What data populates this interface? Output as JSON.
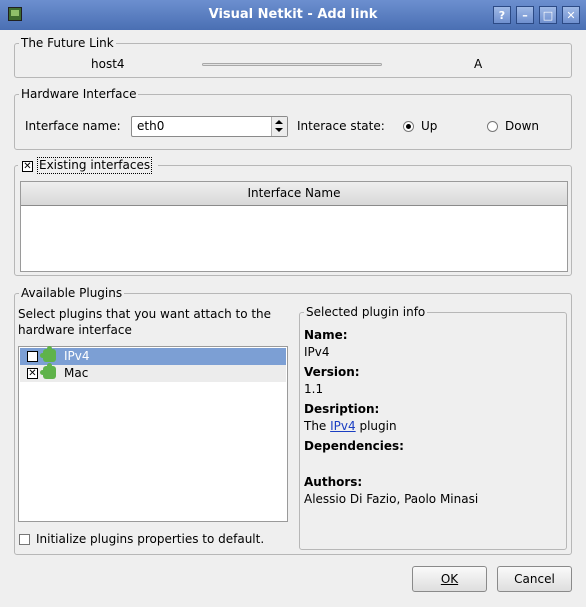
{
  "window": {
    "title": "Visual Netkit - Add link",
    "help_label": "?",
    "minimize_label": "–",
    "maximize_label": "□",
    "close_label": "✕"
  },
  "future_link": {
    "legend": "The Future Link",
    "host": "host4",
    "collision_domain": "A"
  },
  "hardware_interface": {
    "legend": "Hardware Interface",
    "name_label": "Interface name:",
    "name_value": "eth0",
    "state_label": "Interace state:",
    "state_options": [
      "Up",
      "Down"
    ],
    "state_selected": "Up"
  },
  "existing_interfaces": {
    "legend": "Existing interfaces",
    "checked": true,
    "column_header": "Interface Name"
  },
  "available_plugins": {
    "legend": "Available Plugins",
    "instructions": [
      "Select plugins that you want attach to the",
      "hardware interface"
    ],
    "plugins": [
      {
        "name": "IPv4",
        "checked": true,
        "selected": true
      },
      {
        "name": "Mac",
        "checked": true,
        "selected": false
      }
    ],
    "init_default_label": "Initialize plugins properties to default.",
    "init_default_checked": false
  },
  "selected_plugin_info": {
    "legend": "Selected plugin info",
    "name_label": "Name:",
    "name_value": "IPv4",
    "version_label": "Version:",
    "version_value": "1.1",
    "description_label": "Desription:",
    "description_prefix": "The ",
    "description_link": "IPv4",
    "description_suffix": " plugin",
    "dependencies_label": "Dependencies:",
    "authors_label": "Authors:",
    "authors_value": "Alessio Di Fazio, Paolo Minasi"
  },
  "buttons": {
    "ok": "OK",
    "cancel": "Cancel"
  },
  "colors": {
    "titlebar": "#5a7fc2",
    "selection": "#7c9fd4",
    "link": "#1a3ec2"
  }
}
